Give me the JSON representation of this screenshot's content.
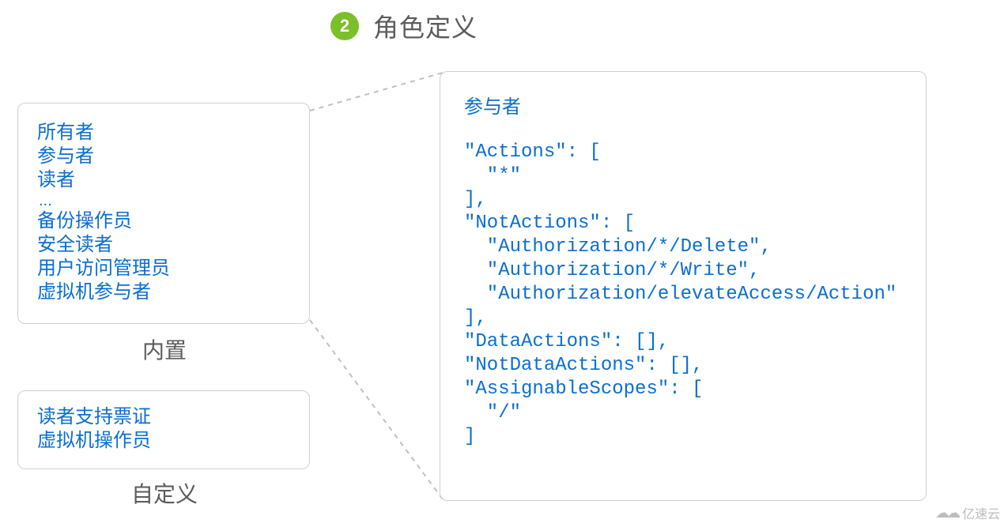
{
  "header": {
    "badge": "2",
    "title": "角色定义"
  },
  "builtin": {
    "label": "内置",
    "items": [
      "所有者",
      "参与者",
      "读者"
    ],
    "ellipsis": "...",
    "items2": [
      "备份操作员",
      "安全读者",
      "用户访问管理员",
      "虚拟机参与者"
    ]
  },
  "custom": {
    "label": "自定义",
    "items": [
      "读者支持票证",
      "虚拟机操作员"
    ]
  },
  "detail": {
    "title": "参与者",
    "code_lines": [
      "\"Actions\": [",
      "  \"*\"",
      "],",
      "\"NotActions\": [",
      "  \"Authorization/*/Delete\",",
      "  \"Authorization/*/Write\",",
      "  \"Authorization/elevateAccess/Action\"",
      "],",
      "\"DataActions\": [],",
      "\"NotDataActions\": [],",
      "\"AssignableScopes\": [",
      "  \"/\"",
      "]"
    ]
  },
  "watermark": "亿速云"
}
